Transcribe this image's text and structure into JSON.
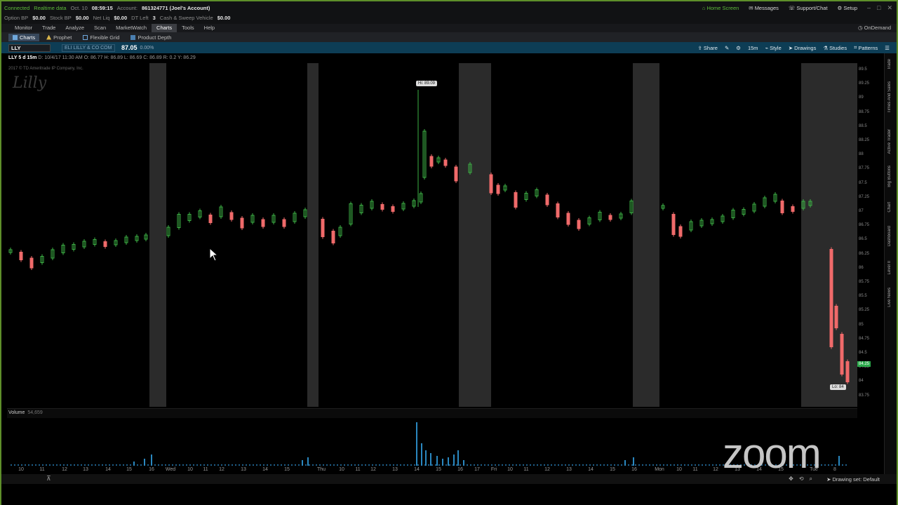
{
  "status": {
    "connected": "Connected",
    "realtime": "Realtime data",
    "date": "Oct. 10",
    "time": "08:59:15",
    "account_label": "Account:",
    "account_value": "861324771 (Joel's Account)",
    "option_bp_label": "Option BP",
    "option_bp": "$0.00",
    "stock_bp_label": "Stock BP",
    "stock_bp": "$0.00",
    "net_liq_label": "Net Liq",
    "net_liq": "$0.00",
    "dt_left_label": "DT Left",
    "dt_left": "3",
    "sweep_label": "Cash & Sweep Vehicle",
    "sweep": "$0.00"
  },
  "top_links": {
    "home": "Home Screen",
    "messages": "Messages",
    "support": "Support/Chat",
    "setup": "Setup"
  },
  "menu": [
    "Monitor",
    "Trade",
    "Analyze",
    "Scan",
    "MarketWatch",
    "Charts",
    "Tools",
    "Help"
  ],
  "menu_active": "Charts",
  "ondemand": "OnDemand",
  "subtabs": [
    "Charts",
    "Prophet",
    "Flexible Grid",
    "Product Depth"
  ],
  "toolbar": {
    "symbol": "LLY",
    "company": "ELI LILLY & CO COM",
    "price": "87.05",
    "change": "0.00%",
    "share": "Share",
    "timeframe": "15m",
    "style": "Style",
    "drawings": "Drawings",
    "studies": "Studies",
    "patterns": "Patterns"
  },
  "info": {
    "title": "LLY 5 d 15m",
    "date": "D: 10/4/17 11:30 AM",
    "open": "O: 86.77",
    "high": "H: 86.89",
    "low": "L: 86.69",
    "close": "C: 86.89",
    "rng": "R: 0.2",
    "mid": "Y: 86.29",
    "copyright": "2017 © TD Ameritrade IP Company, Inc."
  },
  "logo_text": "Lilly",
  "hi_label": "Hi: 89.09",
  "lo_label": "Lo: 84",
  "last_price_tag": "84.25",
  "price_ticks": [
    "89.5",
    "89.25",
    "89",
    "88.75",
    "88.5",
    "88.25",
    "88",
    "87.75",
    "87.5",
    "87.25",
    "87",
    "86.75",
    "86.5",
    "86.25",
    "86",
    "85.75",
    "85.5",
    "85.25",
    "85",
    "84.75",
    "84.5",
    "84.25",
    "84",
    "83.75"
  ],
  "volume": {
    "label": "Volume",
    "value": "54,659"
  },
  "time_ticks": [
    "10",
    "11",
    "12",
    "13",
    "14",
    "15",
    "16",
    "Wed",
    "10",
    "11",
    "12",
    "13",
    "14",
    "15",
    "Thu",
    "10",
    "11",
    "12",
    "13",
    "14",
    "15",
    "16",
    "17",
    "Fri",
    "10",
    "11",
    "12",
    "13",
    "14",
    "15",
    "16",
    "Mon",
    "10",
    "11",
    "12",
    "13",
    "14",
    "15",
    "Tue",
    "8"
  ],
  "right_rail": [
    "Trade",
    "Times And Sales",
    "Active Trader",
    "Big Buttons",
    "Chart",
    "Dashboard",
    "Level II",
    "Live News"
  ],
  "drawing_set": "Drawing set: Default",
  "zoom": "zoom",
  "colors": {
    "up": "#3cb044",
    "down": "#f06a6a",
    "accent": "#5e8f2a",
    "toolbar_bg": "#0d3d55"
  }
}
